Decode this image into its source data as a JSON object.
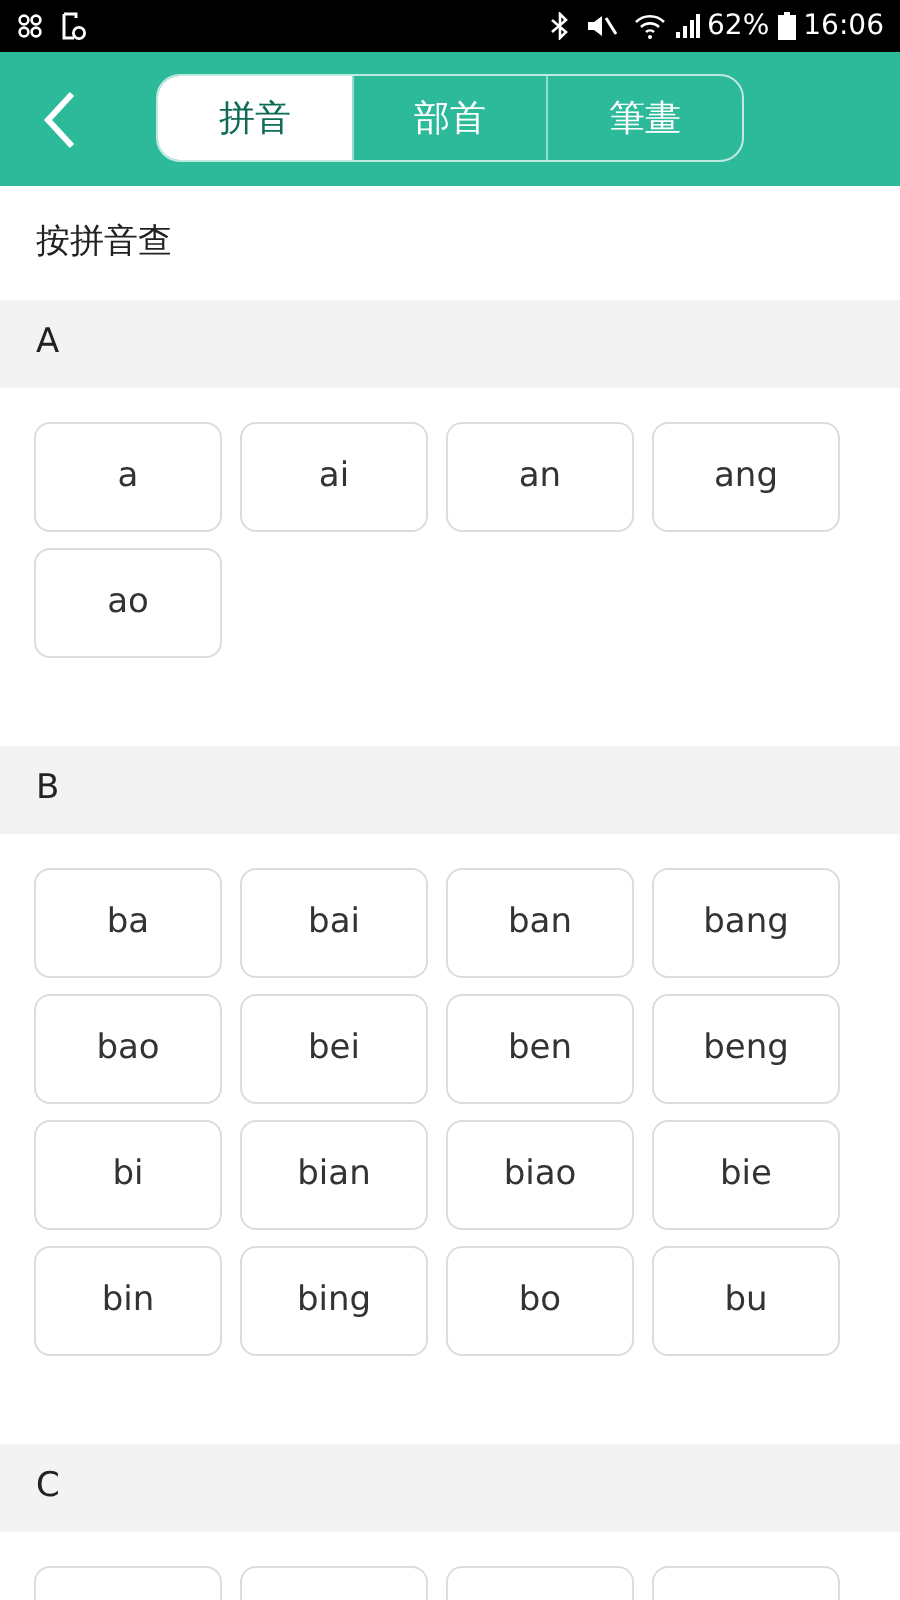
{
  "status_bar": {
    "battery": "62%",
    "time": "16:06"
  },
  "tabs": [
    {
      "label": "拼音",
      "selected": true
    },
    {
      "label": "部首",
      "selected": false
    },
    {
      "label": "筆畫",
      "selected": false
    }
  ],
  "heading": "按拼音查",
  "sections": [
    {
      "letter": "A",
      "syllables": [
        {
          "kind": "syllable",
          "label": "a"
        },
        {
          "kind": "syllable",
          "label": "ai"
        },
        {
          "kind": "syllable",
          "label": "an"
        },
        {
          "kind": "syllable",
          "label": "ang"
        },
        {
          "kind": "syllable",
          "label": "ao"
        }
      ]
    },
    {
      "letter": "B",
      "syllables": [
        {
          "kind": "syllable",
          "label": "ba"
        },
        {
          "kind": "syllable",
          "label": "bai"
        },
        {
          "kind": "syllable",
          "label": "ban"
        },
        {
          "kind": "syllable",
          "label": "bang"
        },
        {
          "kind": "syllable",
          "label": "bao"
        },
        {
          "kind": "syllable",
          "label": "bei"
        },
        {
          "kind": "syllable",
          "label": "ben"
        },
        {
          "kind": "syllable",
          "label": "beng"
        },
        {
          "kind": "syllable",
          "label": "bi"
        },
        {
          "kind": "syllable",
          "label": "bian"
        },
        {
          "kind": "syllable",
          "label": "biao"
        },
        {
          "kind": "syllable",
          "label": "bie"
        },
        {
          "kind": "syllable",
          "label": "bin"
        },
        {
          "kind": "syllable",
          "label": "bing"
        },
        {
          "kind": "syllable",
          "label": "bo"
        },
        {
          "kind": "syllable",
          "label": "bu"
        }
      ]
    },
    {
      "letter": "C",
      "syllables": [
        {
          "kind": "cut_off"
        },
        {
          "kind": "cut_off"
        },
        {
          "kind": "cut_off"
        },
        {
          "kind": "cut_off"
        }
      ]
    }
  ]
}
